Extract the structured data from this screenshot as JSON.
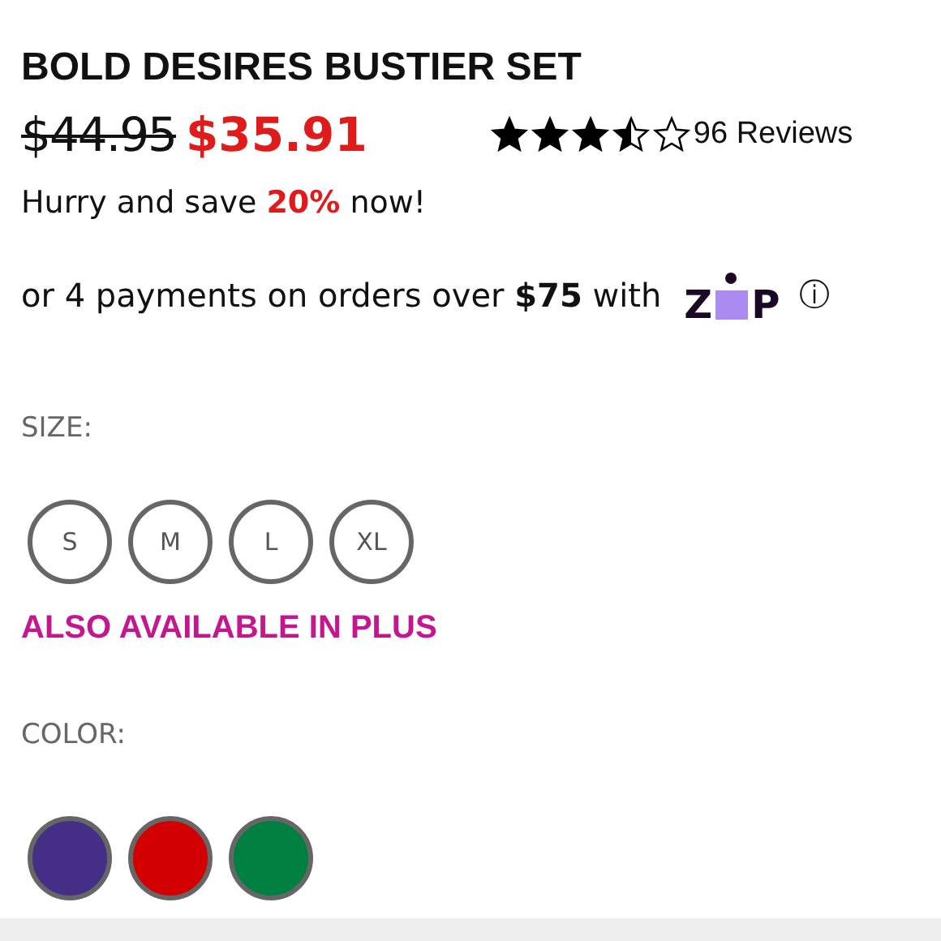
{
  "product": {
    "title": "BOLD DESIRES BUSTIER SET",
    "old_price": "$44.95",
    "price": "$35.91",
    "stars": 3.5,
    "reviews": "96 Reviews"
  },
  "promo": "Hurry and save **20%** now!",
  "payments": {
    "text": "or 4 payments on orders over **$75** with",
    "logo_letters": [
      "Z",
      "P"
    ],
    "info": "ⓘ"
  },
  "size": {
    "label": "SIZE:",
    "options": [
      "S",
      "M",
      "L",
      "XL"
    ]
  },
  "plus_link": "ALSO AVAILABLE IN PLUS",
  "color": {
    "label": "COLOR:",
    "swatches": [
      {
        "color": "#452f86"
      },
      {
        "color": "#d20000"
      },
      {
        "color": "#008040"
      }
    ]
  }
}
